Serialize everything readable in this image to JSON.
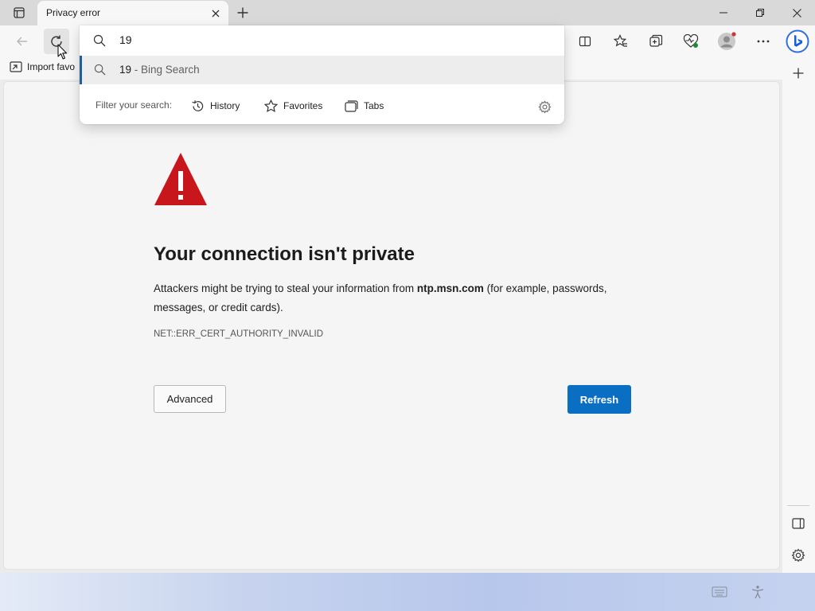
{
  "window": {
    "tab_title": "Privacy error"
  },
  "favorites_bar": {
    "import_label": "Import favo"
  },
  "address_dropdown": {
    "query": "19",
    "suggestion_query": "19",
    "suggestion_suffix": " - Bing Search",
    "filter_label": "Filter your search:",
    "filters": [
      {
        "label": "History",
        "icon": "history-icon"
      },
      {
        "label": "Favorites",
        "icon": "star-icon"
      },
      {
        "label": "Tabs",
        "icon": "tabs-icon"
      }
    ]
  },
  "error_page": {
    "title": "Your connection isn't private",
    "desc_before": "Attackers might be trying to steal your information from ",
    "host": "ntp.msn.com",
    "desc_after": " (for example, passwords, messages, or credit cards).",
    "error_code": "NET::ERR_CERT_AUTHORITY_INVALID",
    "advanced_label": "Advanced",
    "refresh_label": "Refresh"
  },
  "colors": {
    "warning_red": "#c8161d",
    "primary_blue": "#0a6fc2",
    "selected_row_indicator": "#1f5e99"
  }
}
